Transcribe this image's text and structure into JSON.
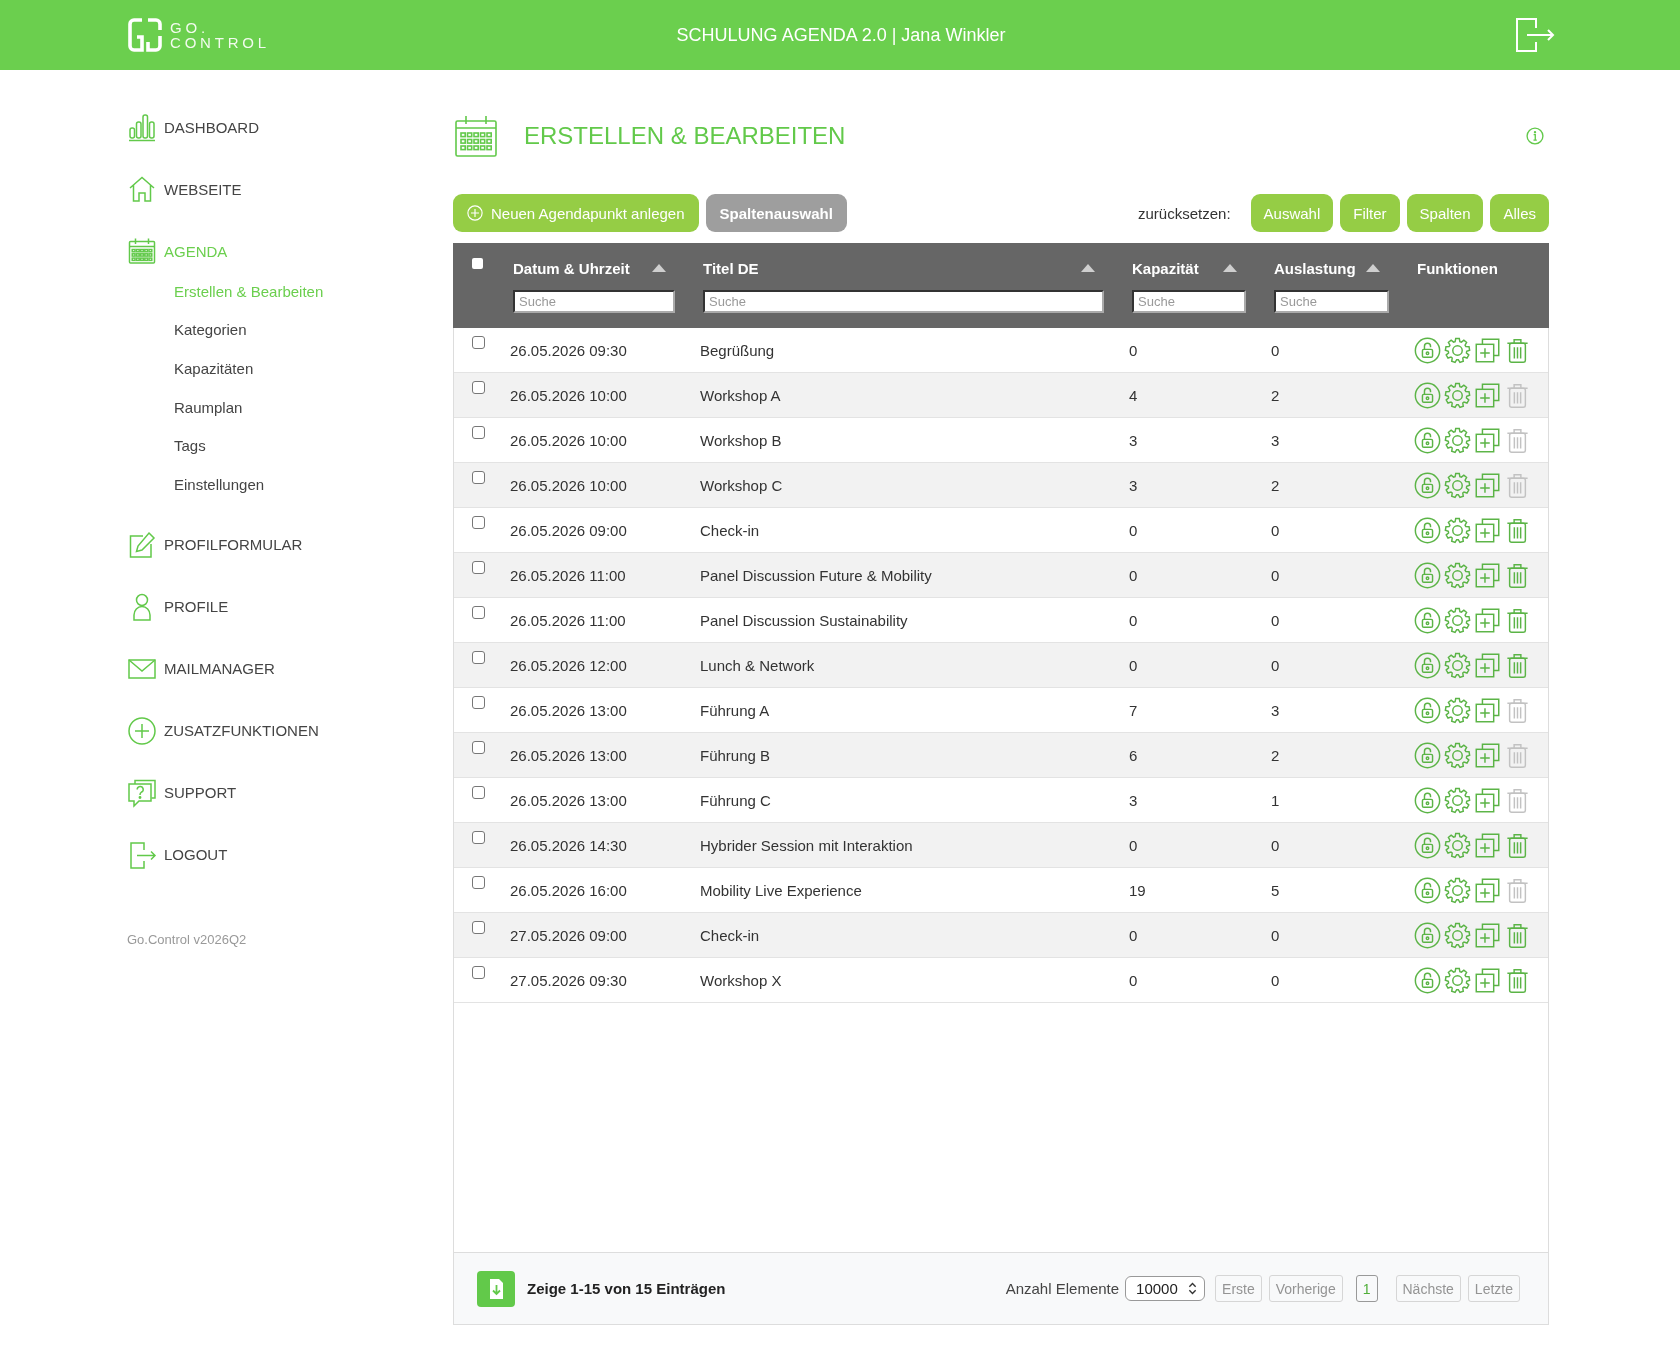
{
  "header": {
    "logo_lines": [
      "GO.",
      "CONTROL"
    ],
    "title": "SCHULUNG AGENDA 2.0 | Jana Winkler"
  },
  "sidebar": {
    "items": [
      {
        "label": "DASHBOARD",
        "selected": false
      },
      {
        "label": "WEBSEITE",
        "selected": false
      },
      {
        "label": "AGENDA",
        "selected": true,
        "children": [
          {
            "label": "Erstellen & Bearbeiten",
            "selected": true
          },
          {
            "label": "Kategorien",
            "selected": false
          },
          {
            "label": "Kapazitäten",
            "selected": false
          },
          {
            "label": "Raumplan",
            "selected": false
          },
          {
            "label": "Tags",
            "selected": false
          },
          {
            "label": "Einstellungen",
            "selected": false
          }
        ]
      },
      {
        "label": "PROFILFORMULAR",
        "selected": false
      },
      {
        "label": "PROFILE",
        "selected": false
      },
      {
        "label": "MAILMANAGER",
        "selected": false
      },
      {
        "label": "ZUSATZFUNKTIONEN",
        "selected": false
      },
      {
        "label": "SUPPORT",
        "selected": false
      },
      {
        "label": "LOGOUT",
        "selected": false
      }
    ],
    "version": "Go.Control v2026Q2"
  },
  "page": {
    "title": "ERSTELLEN & BEARBEITEN"
  },
  "toolbar": {
    "new_button": "Neuen Agendapunkt anlegen",
    "columns_button": "Spaltenauswahl",
    "reset_label": "zurücksetzen:",
    "reset_buttons": [
      "Auswahl",
      "Filter",
      "Spalten",
      "Alles"
    ]
  },
  "table": {
    "select_all_checked": false,
    "columns": [
      {
        "label": "Datum & Uhrzeit",
        "sortable": true,
        "search": {
          "placeholder": "Suche"
        }
      },
      {
        "label": "Titel DE",
        "sortable": true,
        "search": {
          "placeholder": "Suche"
        }
      },
      {
        "label": "Kapazität",
        "sortable": true,
        "search": {
          "placeholder": "Suche"
        }
      },
      {
        "label": "Auslastung",
        "sortable": true,
        "search": {
          "placeholder": "Suche"
        }
      },
      {
        "label": "Funktionen",
        "sortable": false
      }
    ],
    "rows": [
      {
        "checked": false,
        "date": "26.05.2026 09:30",
        "title": "Begrüßung",
        "capacity": "0",
        "utilization": "0",
        "delete_enabled": true
      },
      {
        "checked": false,
        "date": "26.05.2026 10:00",
        "title": "Workshop A",
        "capacity": "4",
        "utilization": "2",
        "delete_enabled": false
      },
      {
        "checked": false,
        "date": "26.05.2026 10:00",
        "title": "Workshop B",
        "capacity": "3",
        "utilization": "3",
        "delete_enabled": false
      },
      {
        "checked": false,
        "date": "26.05.2026 10:00",
        "title": "Workshop C",
        "capacity": "3",
        "utilization": "2",
        "delete_enabled": false
      },
      {
        "checked": false,
        "date": "26.05.2026 09:00",
        "title": "Check-in",
        "capacity": "0",
        "utilization": "0",
        "delete_enabled": true
      },
      {
        "checked": false,
        "date": "26.05.2026 11:00",
        "title": "Panel Discussion Future & Mobility",
        "capacity": "0",
        "utilization": "0",
        "delete_enabled": true
      },
      {
        "checked": false,
        "date": "26.05.2026 11:00",
        "title": "Panel Discussion Sustainability",
        "capacity": "0",
        "utilization": "0",
        "delete_enabled": true
      },
      {
        "checked": false,
        "date": "26.05.2026 12:00",
        "title": "Lunch & Network",
        "capacity": "0",
        "utilization": "0",
        "delete_enabled": true
      },
      {
        "checked": false,
        "date": "26.05.2026 13:00",
        "title": "Führung A",
        "capacity": "7",
        "utilization": "3",
        "delete_enabled": false
      },
      {
        "checked": false,
        "date": "26.05.2026 13:00",
        "title": "Führung B",
        "capacity": "6",
        "utilization": "2",
        "delete_enabled": false
      },
      {
        "checked": false,
        "date": "26.05.2026 13:00",
        "title": "Führung C",
        "capacity": "3",
        "utilization": "1",
        "delete_enabled": false
      },
      {
        "checked": false,
        "date": "26.05.2026 14:30",
        "title": "Hybrider Session mit Interaktion",
        "capacity": "0",
        "utilization": "0",
        "delete_enabled": true
      },
      {
        "checked": false,
        "date": "26.05.2026 16:00",
        "title": "Mobility Live Experience",
        "capacity": "19",
        "utilization": "5",
        "delete_enabled": false
      },
      {
        "checked": false,
        "date": "27.05.2026 09:00",
        "title": "Check-in",
        "capacity": "0",
        "utilization": "0",
        "delete_enabled": true
      },
      {
        "checked": false,
        "date": "27.05.2026 09:30",
        "title": "Workshop X",
        "capacity": "0",
        "utilization": "0",
        "delete_enabled": true
      }
    ]
  },
  "footer": {
    "summary": "Zeige 1-15 von 15 Einträgen",
    "page_size_label": "Anzahl Elemente",
    "page_size": "10000",
    "pagination": [
      {
        "label": "Erste",
        "selected": false,
        "disabled": true
      },
      {
        "label": "Vorherige",
        "selected": false,
        "disabled": true
      },
      {
        "label": "1",
        "selected": true,
        "disabled": false
      },
      {
        "label": "Nächste",
        "selected": false,
        "disabled": true
      },
      {
        "label": "Letzte",
        "selected": false,
        "disabled": true
      }
    ]
  }
}
